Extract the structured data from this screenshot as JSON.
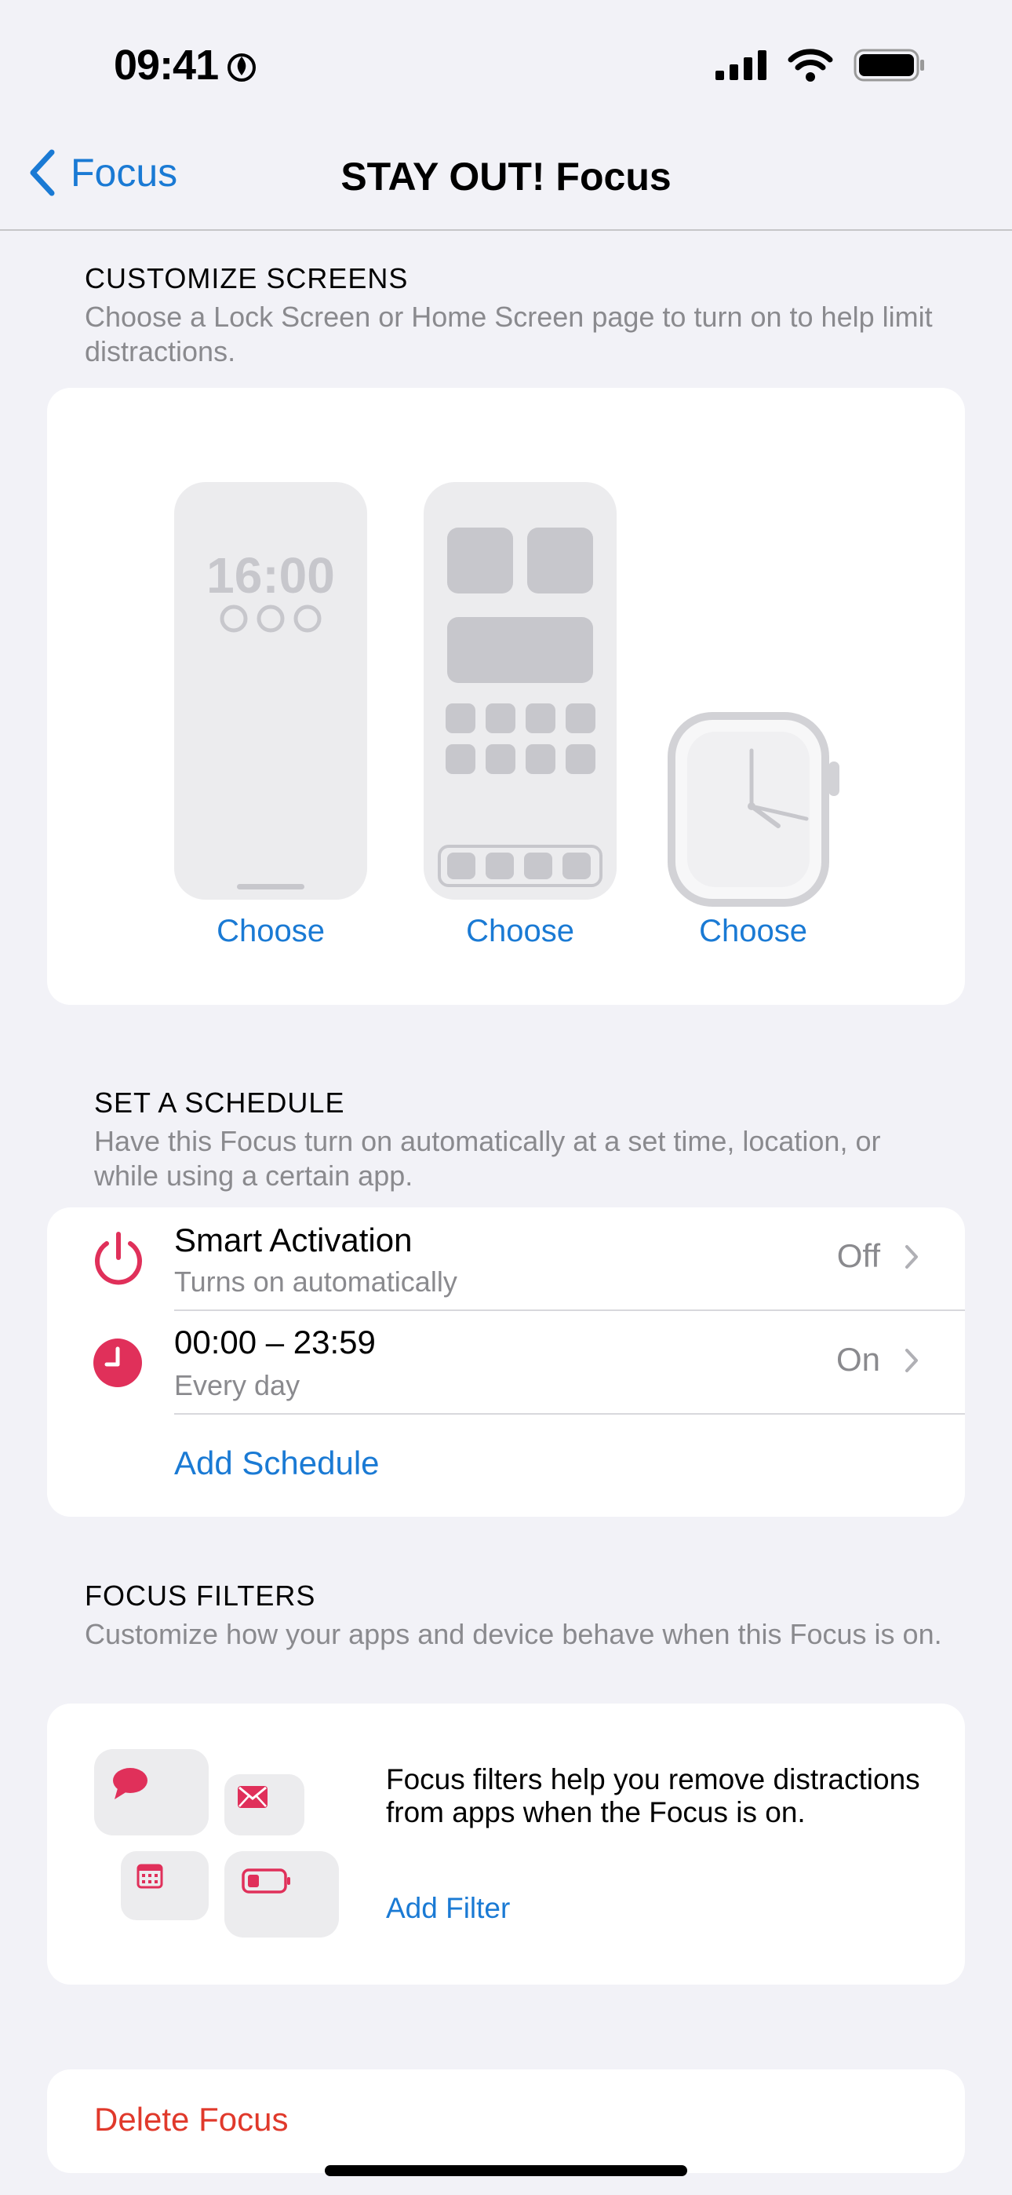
{
  "status": {
    "time": "09:41"
  },
  "nav": {
    "back_label": "Focus",
    "title": "STAY OUT! Focus"
  },
  "customize": {
    "header": "CUSTOMIZE SCREENS",
    "description": "Choose a Lock Screen or Home Screen page to turn on to help limit distractions.",
    "lock_time": "16:00",
    "choose_labels": [
      "Choose",
      "Choose",
      "Choose"
    ]
  },
  "schedule": {
    "header": "SET A SCHEDULE",
    "description": "Have this Focus turn on automatically at a set time, location, or while using a certain app.",
    "rows": [
      {
        "title": "Smart Activation",
        "subtitle": "Turns on automatically",
        "value": "Off",
        "icon": "power-icon"
      },
      {
        "title": "00:00 – 23:59",
        "subtitle": "Every day",
        "value": "On",
        "icon": "clock-icon"
      }
    ],
    "add_label": "Add Schedule",
    "accent": "#e0305a"
  },
  "filters": {
    "header": "FOCUS FILTERS",
    "description": "Customize how your apps and device behave when this Focus is on.",
    "body": "Focus filters help you remove distractions from apps when the Focus is on.",
    "add_label": "Add Filter"
  },
  "delete_label": "Delete Focus",
  "colors": {
    "link": "#1a7ad4",
    "destructive": "#e0392b",
    "accent": "#e0305a"
  }
}
